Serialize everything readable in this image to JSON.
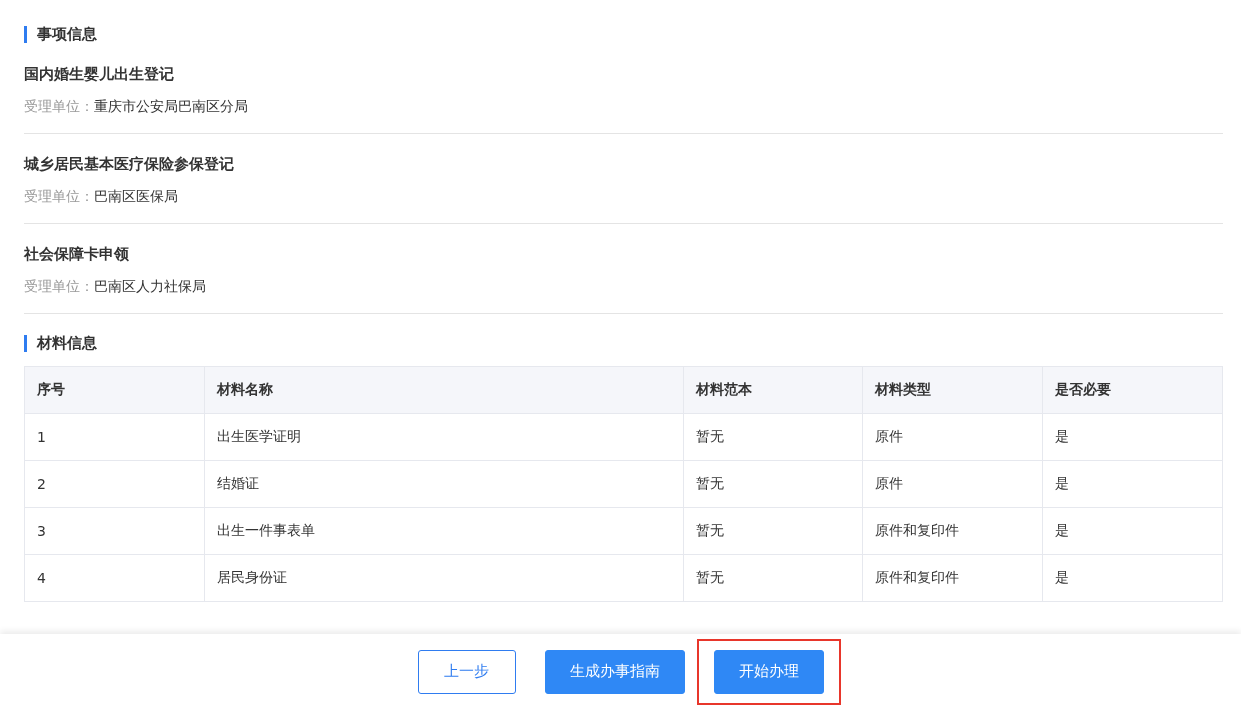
{
  "sections": [
    {
      "title": "事项信息",
      "items": [
        {
          "name": "国内婚生婴儿出生登记",
          "unit_label": "受理单位：",
          "unit": "重庆市公安局巴南区分局"
        },
        {
          "name": "城乡居民基本医疗保险参保登记",
          "unit_label": "受理单位：",
          "unit": "巴南区医保局"
        },
        {
          "name": "社会保障卡申领",
          "unit_label": "受理单位：",
          "unit": "巴南区人力社保局"
        }
      ]
    }
  ],
  "materials": {
    "title": "材料信息",
    "columns": [
      "序号",
      "材料名称",
      "材料范本",
      "材料类型",
      "是否必要"
    ],
    "rows": [
      [
        "1",
        "出生医学证明",
        "暂无",
        "原件",
        "是"
      ],
      [
        "2",
        "结婚证",
        "暂无",
        "原件",
        "是"
      ],
      [
        "3",
        "出生一件事表单",
        "暂无",
        "原件和复印件",
        "是"
      ],
      [
        "4",
        "居民身份证",
        "暂无",
        "原件和复印件",
        "是"
      ]
    ]
  },
  "buttons": [
    {
      "label": "上一步",
      "kind": "outline",
      "highlighted": false
    },
    {
      "label": "生成办事指南",
      "kind": "primary",
      "highlighted": false
    },
    {
      "label": "开始办理",
      "kind": "primary",
      "highlighted": true
    }
  ]
}
